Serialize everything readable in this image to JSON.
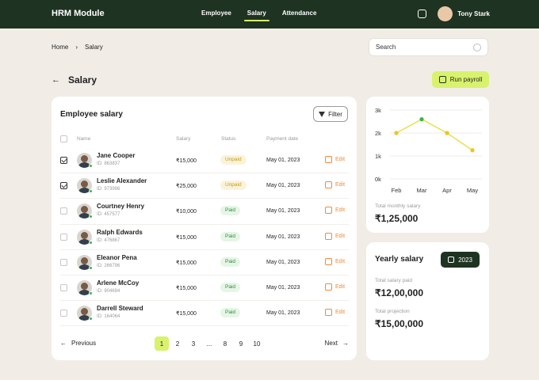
{
  "app": {
    "title": "HRM Module",
    "user_name": "Tony Stark"
  },
  "nav": {
    "items": [
      {
        "label": "Employee"
      },
      {
        "label": "Salary",
        "active": true
      },
      {
        "label": "Attendance"
      }
    ]
  },
  "breadcrumb": {
    "home": "Home",
    "current": "Salary"
  },
  "search": {
    "placeholder": "Search"
  },
  "page": {
    "title": "Salary",
    "run_payroll": "Run payroll"
  },
  "employee_card": {
    "title": "Employee salary",
    "filter_label": "Filter",
    "columns": {
      "name": "Name",
      "salary": "Salary",
      "status": "Status",
      "payment_date": "Payment date"
    },
    "rows": [
      {
        "name": "Jane Cooper",
        "id": "ID: 863837",
        "salary": "₹15,000",
        "status": "Unpaid",
        "date": "May 01, 2023",
        "edit": "Edit",
        "checked": true
      },
      {
        "name": "Leslie Alexander",
        "id": "ID: 973996",
        "salary": "₹25,000",
        "status": "Unpaid",
        "date": "May 01, 2023",
        "edit": "Edit",
        "checked": true
      },
      {
        "name": "Courtney Henry",
        "id": "ID: 457577",
        "salary": "₹10,000",
        "status": "Paid",
        "date": "May 01, 2023",
        "edit": "Edit",
        "checked": false
      },
      {
        "name": "Ralph Edwards",
        "id": "ID: 476867",
        "salary": "₹15,000",
        "status": "Paid",
        "date": "May 01, 2023",
        "edit": "Edit",
        "checked": false
      },
      {
        "name": "Eleanor Pena",
        "id": "ID: 266796",
        "salary": "₹15,000",
        "status": "Paid",
        "date": "May 01, 2023",
        "edit": "Edit",
        "checked": false
      },
      {
        "name": "Arlene McCoy",
        "id": "ID: 904694",
        "salary": "₹15,000",
        "status": "Paid",
        "date": "May 01, 2023",
        "edit": "Edit",
        "checked": false
      },
      {
        "name": "Darrell Steward",
        "id": "ID: 164064",
        "salary": "₹15,000",
        "status": "Paid",
        "date": "May 01, 2023",
        "edit": "Edit",
        "checked": false
      }
    ],
    "pagination": {
      "previous": "Previous",
      "next": "Next",
      "pages": [
        "1",
        "2",
        "3",
        "...",
        "8",
        "9",
        "10"
      ],
      "active_page": "1"
    }
  },
  "chart_data": {
    "type": "line",
    "categories": [
      "Feb",
      "Mar",
      "Apr",
      "May"
    ],
    "values": [
      2000,
      2600,
      2000,
      1250
    ],
    "y_ticks": [
      "0k",
      "1k",
      "2k",
      "3k"
    ],
    "ylim": [
      0,
      3000
    ],
    "grid": true,
    "line_color": "#e3e24a",
    "highlight_index": 1,
    "highlight_color": "#3ab54a",
    "point_color": "#f2c318"
  },
  "summary": {
    "total_monthly_label": "Total monthly salary",
    "total_monthly_value": "₹1,25,000"
  },
  "yearly": {
    "title": "Yearly salary",
    "year": "2023",
    "total_paid_label": "Total salary paid",
    "total_paid_value": "₹12,00,000",
    "projection_label": "Total projection",
    "projection_value": "₹15,00,000"
  },
  "colors": {
    "topbar": "#1e3321",
    "accent": "#d9f26d",
    "background": "#f1ede6"
  }
}
